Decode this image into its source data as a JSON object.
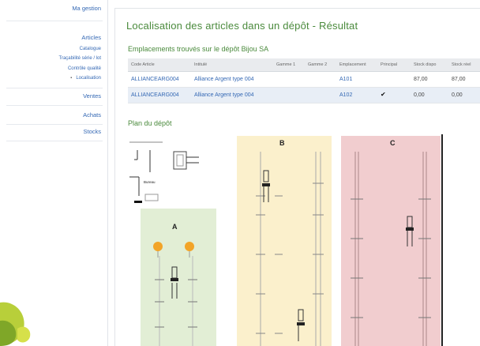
{
  "sidebar": {
    "items": [
      {
        "label": "Ma gestion",
        "kind": "section"
      },
      {
        "label": "Articles",
        "kind": "section"
      },
      {
        "label": "Catalogue",
        "kind": "sub"
      },
      {
        "label": "Traçabilité série / lot",
        "kind": "sub"
      },
      {
        "label": "Contrôle qualité",
        "kind": "sub"
      },
      {
        "label": "Localisation",
        "kind": "sub-active"
      },
      {
        "label": "Ventes",
        "kind": "section"
      },
      {
        "label": "Achats",
        "kind": "section"
      },
      {
        "label": "Stocks",
        "kind": "section"
      }
    ],
    "bullet": "▪"
  },
  "main": {
    "title": "Localisation des articles dans un dépôt - Résultat",
    "subtitle": "Emplacements trouvés sur le dépôt Bijou SA",
    "plan_title": "Plan du dépôt",
    "table": {
      "headers": [
        "Code Article",
        "Intitulé",
        "Gamme 1",
        "Gamme 2",
        "Emplacement",
        "Principal",
        "Stock dispo",
        "Stock réel"
      ],
      "rows": [
        {
          "code": "ALLIANCEARG004",
          "intitule": "Alliance Argent type 004",
          "gamme1": "",
          "gamme2": "",
          "emplacement": "A101",
          "principal": "",
          "dispo": "87,00",
          "reel": "87,00"
        },
        {
          "code": "ALLIANCEARG004",
          "intitule": "Alliance Argent type 004",
          "gamme1": "",
          "gamme2": "",
          "emplacement": "A102",
          "principal": "✔",
          "dispo": "0,00",
          "reel": "0,00"
        }
      ]
    },
    "plan": {
      "office_label": "Bureau",
      "zones": [
        {
          "label": "A",
          "color": "#e2eed5"
        },
        {
          "label": "B",
          "color": "#fbf0cc"
        },
        {
          "label": "C",
          "color": "#f1cdcf"
        }
      ],
      "marker_color": "#f2a428"
    }
  },
  "colors": {
    "accent_green": "#4a8a3c",
    "link_blue": "#3468b4",
    "header_bg": "#e9ebee",
    "selected_row": "#e8eef6"
  }
}
